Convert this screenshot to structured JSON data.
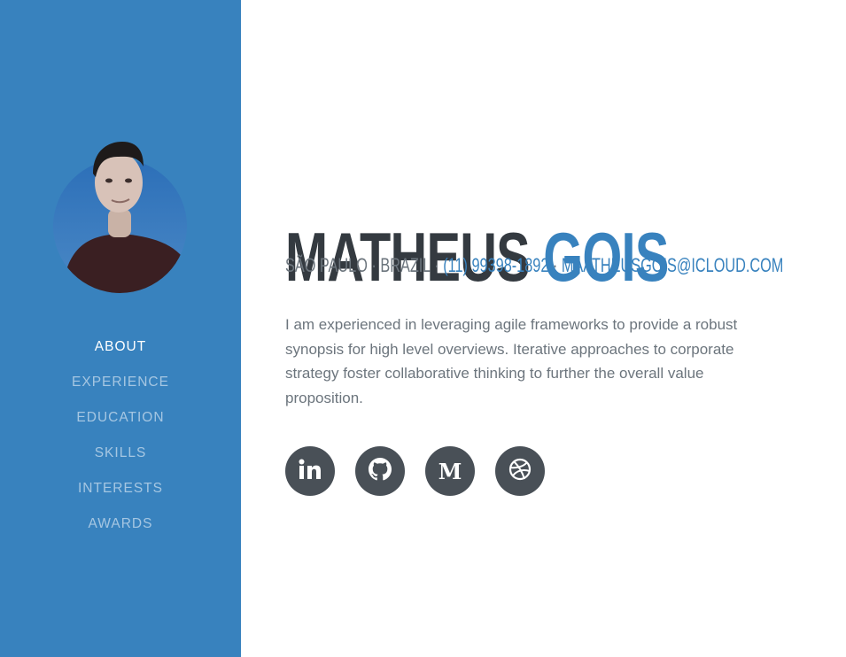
{
  "profile": {
    "first_name": "MATHEUS",
    "last_name": "GOIS",
    "location": "SÃO PAULO · BRAZIL",
    "separator": " · ",
    "phone": "(11) 99398-1892",
    "email": "MAATHEUSGOIS@ICLOUD.COM",
    "bio": "I am experienced in leveraging agile frameworks to provide a robust synopsis for high level overviews. Iterative approaches to corporate strategy foster collaborative thinking to further the overall value proposition."
  },
  "nav": {
    "items": [
      {
        "label": "ABOUT",
        "active": true
      },
      {
        "label": "EXPERIENCE"
      },
      {
        "label": "EDUCATION"
      },
      {
        "label": "SKILLS"
      },
      {
        "label": "INTERESTS"
      },
      {
        "label": "AWARDS"
      }
    ]
  },
  "social": {
    "icons": [
      "linkedin-icon",
      "github-icon",
      "medium-icon",
      "dribbble-icon"
    ],
    "medium_letter": "M"
  },
  "colors": {
    "primary": "#3882be",
    "dark_text": "#343a40",
    "muted_text": "#6c757d",
    "social_bg": "#495057"
  }
}
